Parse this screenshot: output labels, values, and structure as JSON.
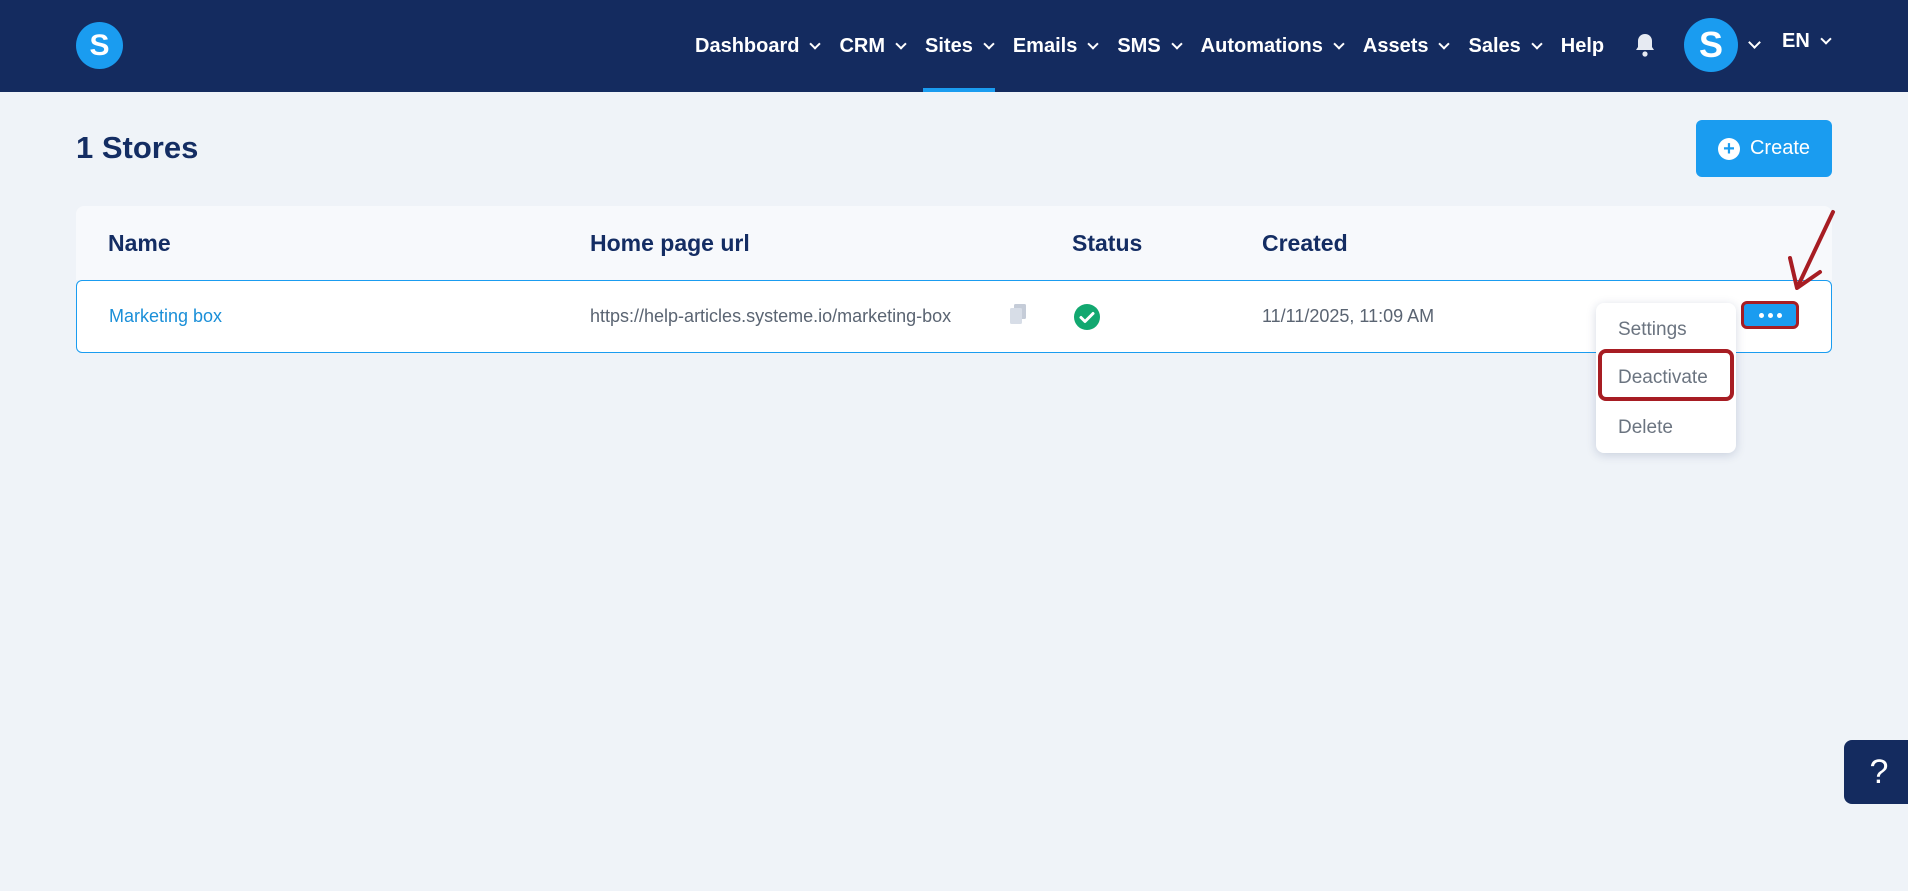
{
  "nav": {
    "items": [
      {
        "label": "Dashboard",
        "dropdown": true
      },
      {
        "label": "CRM",
        "dropdown": true
      },
      {
        "label": "Sites",
        "dropdown": true,
        "active": true
      },
      {
        "label": "Emails",
        "dropdown": true
      },
      {
        "label": "SMS",
        "dropdown": true
      },
      {
        "label": "Automations",
        "dropdown": true
      },
      {
        "label": "Assets",
        "dropdown": true
      },
      {
        "label": "Sales",
        "dropdown": true
      },
      {
        "label": "Help",
        "dropdown": false
      }
    ],
    "logo_letter": "S",
    "avatar_letter": "S",
    "language": "EN"
  },
  "page": {
    "title": "1 Stores",
    "create_label": "Create"
  },
  "table": {
    "columns": [
      "Name",
      "Home page url",
      "Status",
      "Created"
    ],
    "rows": [
      {
        "name": "Marketing box",
        "url": "https://help-articles.systeme.io/marketing-box",
        "status": "active",
        "created": "11/11/2025, 11:09 AM"
      }
    ]
  },
  "menu": {
    "items": [
      "Settings",
      "Deactivate",
      "Delete"
    ],
    "highlighted": "Deactivate"
  },
  "help_fab": "?",
  "colors": {
    "nav_bg": "#142b5f",
    "accent": "#1a9cf0",
    "annotation": "#a71d23",
    "success": "#12a870"
  },
  "icons": [
    "bell-icon",
    "copy-icon",
    "check-circle-icon",
    "more-dots-icon",
    "plus-circle-icon",
    "chevron-down-icon",
    "help-icon"
  ]
}
